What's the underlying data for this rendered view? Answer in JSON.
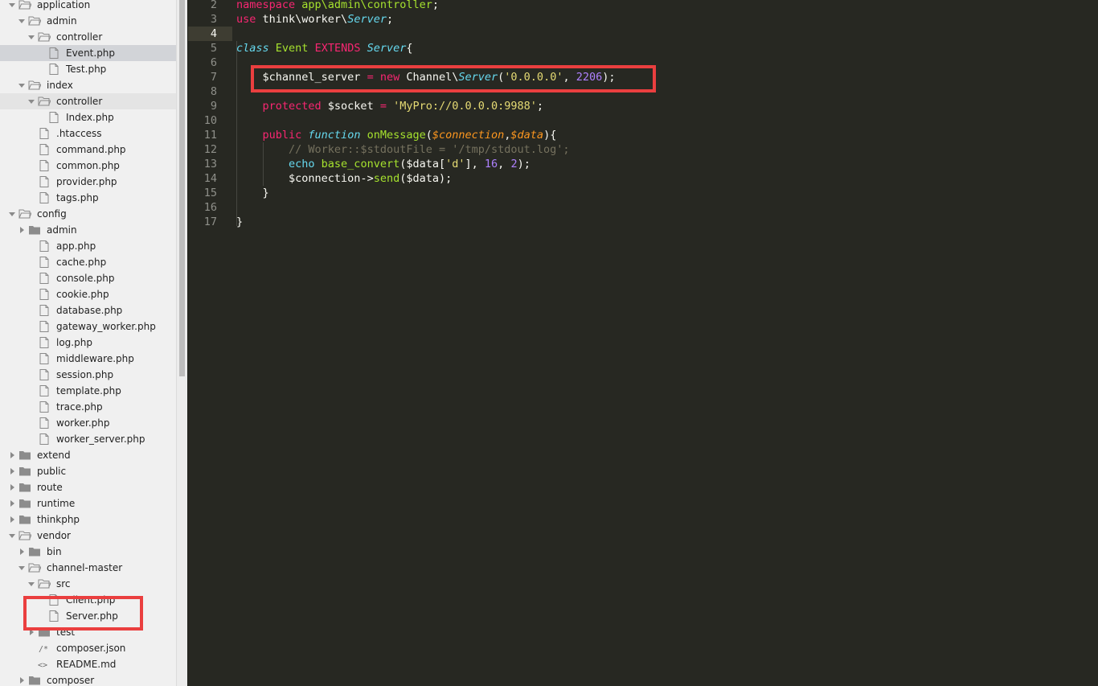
{
  "sidebar": {
    "items": [
      {
        "label": "application",
        "kind": "folder",
        "open": true,
        "depth": 0
      },
      {
        "label": "admin",
        "kind": "folder",
        "open": true,
        "depth": 1
      },
      {
        "label": "controller",
        "kind": "folder",
        "open": true,
        "depth": 2
      },
      {
        "label": "Event.php",
        "kind": "file",
        "depth": 3,
        "selected": true
      },
      {
        "label": "Test.php",
        "kind": "file",
        "depth": 3
      },
      {
        "label": "index",
        "kind": "folder",
        "open": true,
        "depth": 1
      },
      {
        "label": "controller",
        "kind": "folder",
        "open": true,
        "depth": 2,
        "highlight": true
      },
      {
        "label": "Index.php",
        "kind": "file",
        "depth": 3
      },
      {
        "label": ".htaccess",
        "kind": "file",
        "depth": 2
      },
      {
        "label": "command.php",
        "kind": "file",
        "depth": 2
      },
      {
        "label": "common.php",
        "kind": "file",
        "depth": 2
      },
      {
        "label": "provider.php",
        "kind": "file",
        "depth": 2
      },
      {
        "label": "tags.php",
        "kind": "file",
        "depth": 2
      },
      {
        "label": "config",
        "kind": "folder",
        "open": true,
        "depth": 0
      },
      {
        "label": "admin",
        "kind": "folder",
        "open": false,
        "depth": 1
      },
      {
        "label": "app.php",
        "kind": "file",
        "depth": 2
      },
      {
        "label": "cache.php",
        "kind": "file",
        "depth": 2
      },
      {
        "label": "console.php",
        "kind": "file",
        "depth": 2
      },
      {
        "label": "cookie.php",
        "kind": "file",
        "depth": 2
      },
      {
        "label": "database.php",
        "kind": "file",
        "depth": 2
      },
      {
        "label": "gateway_worker.php",
        "kind": "file",
        "depth": 2
      },
      {
        "label": "log.php",
        "kind": "file",
        "depth": 2
      },
      {
        "label": "middleware.php",
        "kind": "file",
        "depth": 2
      },
      {
        "label": "session.php",
        "kind": "file",
        "depth": 2
      },
      {
        "label": "template.php",
        "kind": "file",
        "depth": 2
      },
      {
        "label": "trace.php",
        "kind": "file",
        "depth": 2
      },
      {
        "label": "worker.php",
        "kind": "file",
        "depth": 2
      },
      {
        "label": "worker_server.php",
        "kind": "file",
        "depth": 2
      },
      {
        "label": "extend",
        "kind": "folder",
        "open": false,
        "depth": 0
      },
      {
        "label": "public",
        "kind": "folder",
        "open": false,
        "depth": 0
      },
      {
        "label": "route",
        "kind": "folder",
        "open": false,
        "depth": 0
      },
      {
        "label": "runtime",
        "kind": "folder",
        "open": false,
        "depth": 0
      },
      {
        "label": "thinkphp",
        "kind": "folder",
        "open": false,
        "depth": 0
      },
      {
        "label": "vendor",
        "kind": "folder",
        "open": true,
        "depth": 0
      },
      {
        "label": "bin",
        "kind": "folder",
        "open": false,
        "depth": 1
      },
      {
        "label": "channel-master",
        "kind": "folder",
        "open": true,
        "depth": 1
      },
      {
        "label": "src",
        "kind": "folder",
        "open": true,
        "depth": 2
      },
      {
        "label": "Client.php",
        "kind": "file",
        "depth": 3
      },
      {
        "label": "Server.php",
        "kind": "file",
        "depth": 3
      },
      {
        "label": "test",
        "kind": "folder",
        "open": false,
        "depth": 2
      },
      {
        "label": "composer.json",
        "kind": "json",
        "depth": 2
      },
      {
        "label": "README.md",
        "kind": "md",
        "depth": 2
      },
      {
        "label": "composer",
        "kind": "folder",
        "open": false,
        "depth": 1
      }
    ]
  },
  "editor": {
    "line_numbers": [
      "2",
      "3",
      "4",
      "5",
      "6",
      "7",
      "8",
      "9",
      "10",
      "11",
      "12",
      "13",
      "14",
      "15",
      "16",
      "17"
    ],
    "current_line": "4",
    "lines": [
      [
        {
          "t": "namespace ",
          "c": "kw"
        },
        {
          "t": "app\\admin\\controller",
          "c": "ns"
        },
        {
          "t": ";",
          "c": ""
        }
      ],
      [
        {
          "t": "use ",
          "c": "kw"
        },
        {
          "t": "think\\worker\\",
          "c": ""
        },
        {
          "t": "Server",
          "c": "it"
        },
        {
          "t": ";",
          "c": ""
        }
      ],
      [],
      [
        {
          "t": "class ",
          "c": "it"
        },
        {
          "t": "Event ",
          "c": "cls"
        },
        {
          "t": "EXTENDS ",
          "c": "kw"
        },
        {
          "t": "Server",
          "c": "it"
        },
        {
          "t": "{",
          "c": ""
        }
      ],
      [],
      [
        {
          "t": "    ",
          "c": ""
        },
        {
          "t": "$channel_server ",
          "c": ""
        },
        {
          "t": "= ",
          "c": "kw"
        },
        {
          "t": "new ",
          "c": "kw"
        },
        {
          "t": "Channel\\",
          "c": ""
        },
        {
          "t": "Server",
          "c": "it"
        },
        {
          "t": "(",
          "c": ""
        },
        {
          "t": "'0.0.0.0'",
          "c": "str"
        },
        {
          "t": ", ",
          "c": ""
        },
        {
          "t": "2206",
          "c": "num"
        },
        {
          "t": ");",
          "c": ""
        }
      ],
      [],
      [
        {
          "t": "    ",
          "c": ""
        },
        {
          "t": "protected ",
          "c": "kw"
        },
        {
          "t": "$socket ",
          "c": ""
        },
        {
          "t": "= ",
          "c": "kw"
        },
        {
          "t": "'MyPro://0.0.0.0:9988'",
          "c": "str"
        },
        {
          "t": ";",
          "c": ""
        }
      ],
      [],
      [
        {
          "t": "    ",
          "c": ""
        },
        {
          "t": "public ",
          "c": "kw"
        },
        {
          "t": "function ",
          "c": "it"
        },
        {
          "t": "onMessage",
          "c": "fn"
        },
        {
          "t": "(",
          "c": ""
        },
        {
          "t": "$connection",
          "c": "var"
        },
        {
          "t": ",",
          "c": ""
        },
        {
          "t": "$data",
          "c": "var"
        },
        {
          "t": "){",
          "c": ""
        }
      ],
      [
        {
          "t": "        ",
          "c": ""
        },
        {
          "t": "// Worker::$stdoutFile = '/tmp/stdout.log';",
          "c": "cmt"
        }
      ],
      [
        {
          "t": "        ",
          "c": ""
        },
        {
          "t": "echo ",
          "c": "blue"
        },
        {
          "t": "base_convert",
          "c": "fn"
        },
        {
          "t": "($data[",
          "c": ""
        },
        {
          "t": "'d'",
          "c": "str"
        },
        {
          "t": "], ",
          "c": ""
        },
        {
          "t": "16",
          "c": "num"
        },
        {
          "t": ", ",
          "c": ""
        },
        {
          "t": "2",
          "c": "num"
        },
        {
          "t": ");",
          "c": ""
        }
      ],
      [
        {
          "t": "        ",
          "c": ""
        },
        {
          "t": "$connection->",
          "c": ""
        },
        {
          "t": "send",
          "c": "fn"
        },
        {
          "t": "($data);",
          "c": ""
        }
      ],
      [
        {
          "t": "    }",
          "c": ""
        }
      ],
      [],
      [
        {
          "t": "}",
          "c": ""
        }
      ]
    ]
  },
  "colors": {
    "editor_bg": "#272822",
    "sidebar_bg": "#f0f0f0",
    "annotation_red": "#ea3f3f",
    "keyword": "#f92672",
    "string": "#e6db74",
    "number": "#ae81ff",
    "function": "#a6e22e"
  }
}
